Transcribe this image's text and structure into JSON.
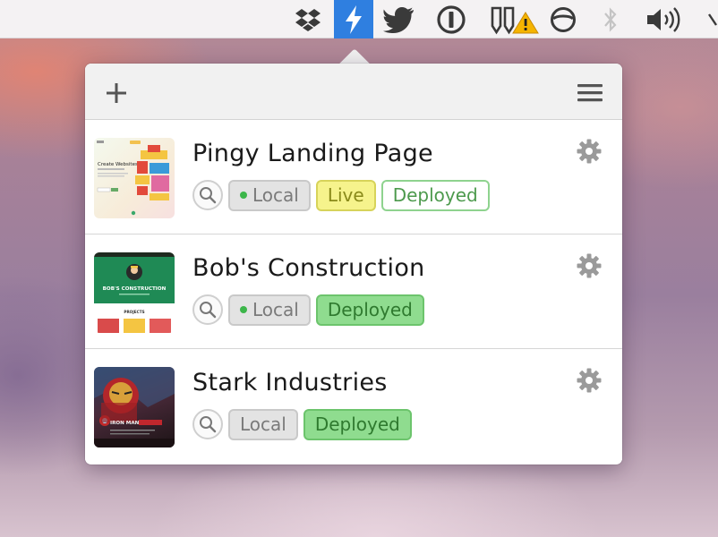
{
  "menubar": {
    "icons": [
      "dropbox-icon",
      "pingy-bolt-icon",
      "twitter-icon",
      "onepassword-icon",
      "warning-icon",
      "sync-icon",
      "bluetooth-icon",
      "volume-icon"
    ],
    "active_color": "#2f7fe0"
  },
  "popover": {
    "add_label": "+",
    "projects": [
      {
        "title": "Pingy Landing Page",
        "local_label": "Local",
        "live_label": "Live",
        "deployed_label": "Deployed",
        "thumb_text": "Create Websites"
      },
      {
        "title": "Bob's Construction",
        "local_label": "Local",
        "deployed_label": "Deployed",
        "thumb_text": "BOB'S CONSTRUCTION",
        "thumb_sub": "PROJECTS"
      },
      {
        "title": "Stark Industries",
        "local_label": "Local",
        "deployed_label": "Deployed",
        "thumb_text": "IRON MAN"
      }
    ]
  },
  "colors": {
    "local_dot": "#3cb64a",
    "live": "#f6f38c",
    "deployed": "#8fdc8f"
  }
}
